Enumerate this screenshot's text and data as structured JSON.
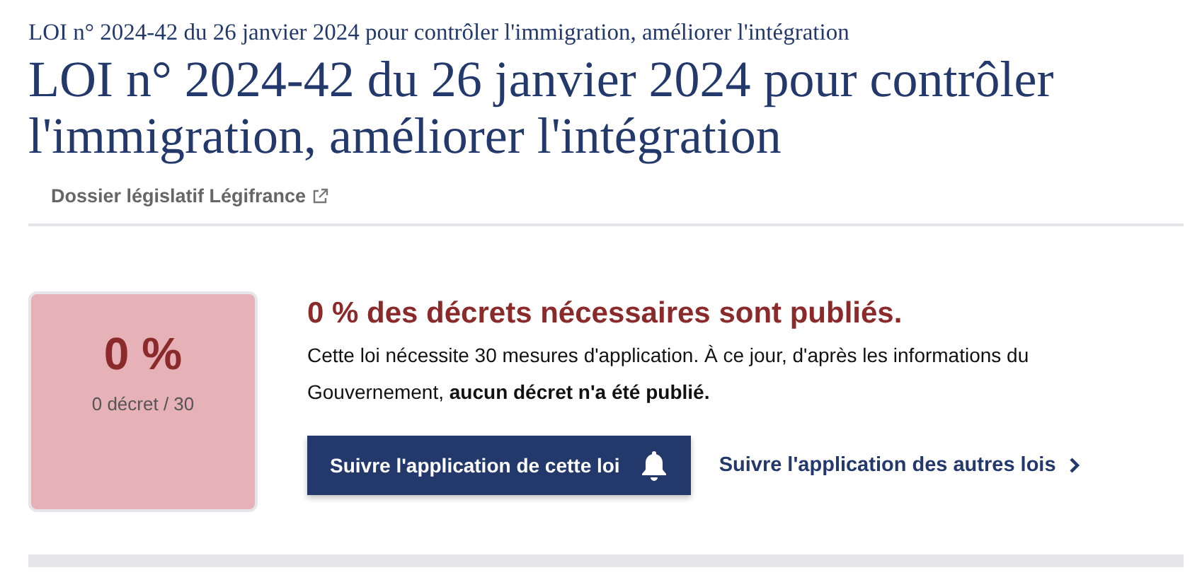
{
  "breadcrumb": "LOI n° 2024-42 du 26 janvier 2024 pour contrôler l'immigration, améliorer l'intégration",
  "title": "LOI n° 2024-42 du 26 janvier 2024 pour contrôler l'immigration, améliorer l'intégration",
  "dossier_link": "Dossier législatif Légifrance",
  "summary_card": {
    "percent": "0 %",
    "count": "0 décret / 30"
  },
  "headline": "0 % des décrets nécessaires sont publiés.",
  "description": "Cette loi nécessite 30 mesures d'application. À ce jour, d'après les informations du Gouvernement, **aucun décret n'a été publié.**",
  "follow_button": "Suivre l'application de cette loi",
  "other_laws_link": "Suivre l'application des autres lois"
}
